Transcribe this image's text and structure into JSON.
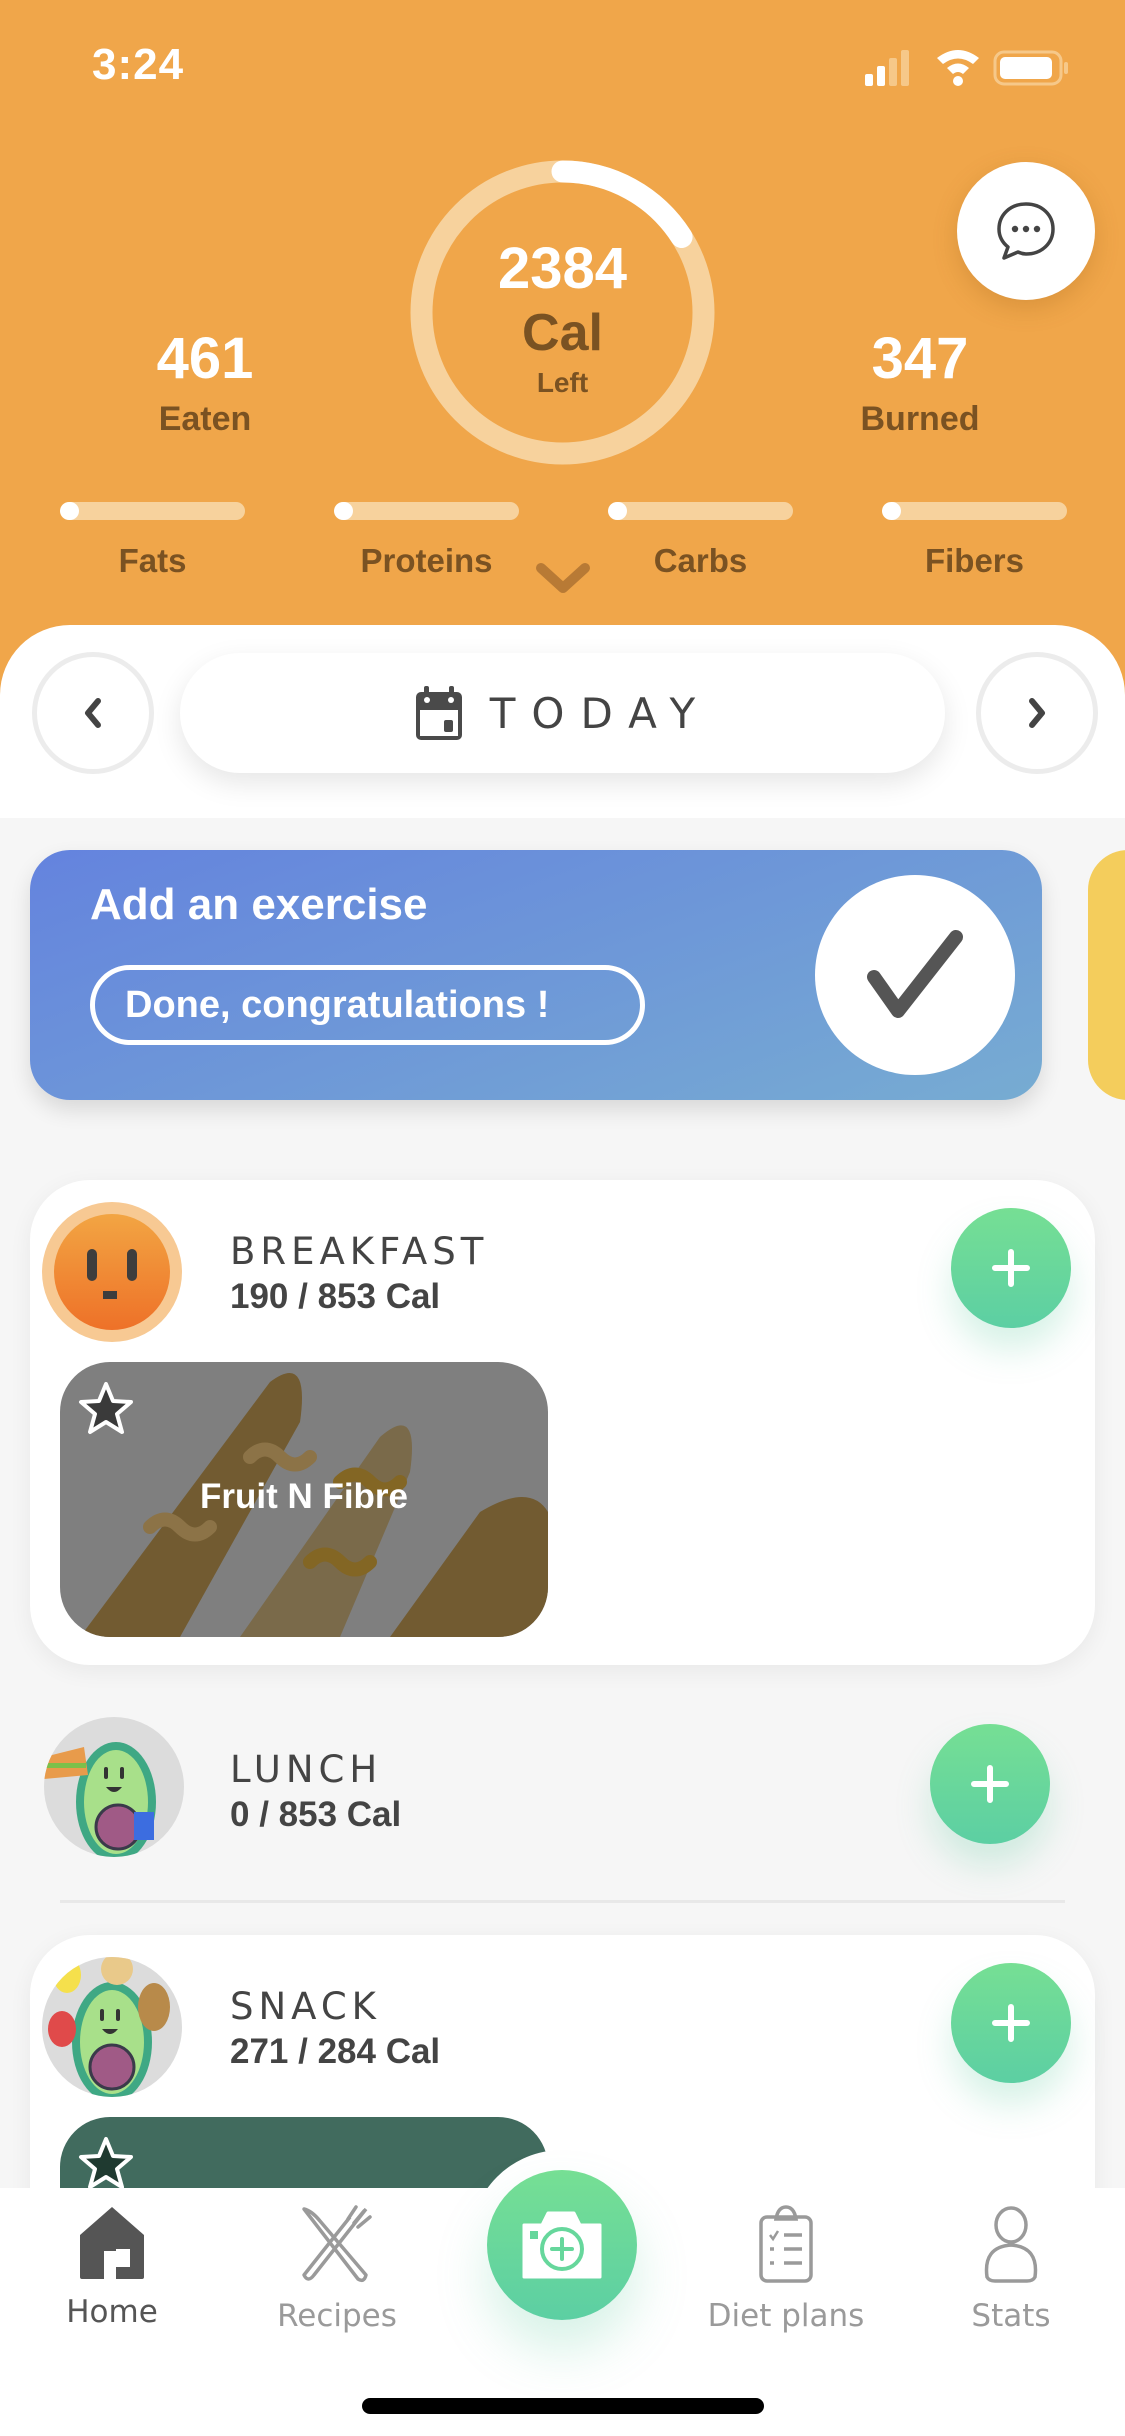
{
  "status_bar": {
    "time": "3:24",
    "icons": [
      "signal-icon",
      "wifi-icon",
      "battery-icon"
    ]
  },
  "summary": {
    "calories_left": "2384",
    "calories_unit": "Cal",
    "calories_sub": "Left",
    "ring_progress": 0.16,
    "eaten": {
      "value": "461",
      "label": "Eaten"
    },
    "burned": {
      "value": "347",
      "label": "Burned"
    },
    "macros": [
      {
        "label": "Fats",
        "progress": 0.08
      },
      {
        "label": "Proteins",
        "progress": 0.08
      },
      {
        "label": "Carbs",
        "progress": 0.08
      },
      {
        "label": "Fibers",
        "progress": 0.08
      }
    ],
    "chat_icon": "chat-bubble-icon",
    "expand_icon": "chevron-down-icon"
  },
  "date_nav": {
    "label": "TODAY",
    "prev_icon": "chevron-left-icon",
    "next_icon": "chevron-right-icon",
    "calendar_icon": "calendar-icon"
  },
  "exercise": {
    "title": "Add an exercise",
    "status": "Done, congratulations !",
    "check_icon": "checkmark-icon"
  },
  "meals": [
    {
      "name": "BREAKFAST",
      "calories": "190 / 853 Cal",
      "items": [
        {
          "name": "Fruit N Fibre"
        }
      ]
    },
    {
      "name": "LUNCH",
      "calories": "0 / 853 Cal",
      "items": []
    },
    {
      "name": "SNACK",
      "calories": "271 / 284 Cal",
      "items": [
        {
          "name": ""
        }
      ]
    }
  ],
  "tabbar": {
    "tabs": [
      {
        "label": "Home",
        "icon": "home-icon",
        "active": true
      },
      {
        "label": "Recipes",
        "icon": "fork-knife-icon",
        "active": false
      },
      {
        "label": "Diet plans",
        "icon": "clipboard-icon",
        "active": false
      },
      {
        "label": "Stats",
        "icon": "person-icon",
        "active": false
      }
    ],
    "camera_icon": "camera-add-icon"
  },
  "colors": {
    "header": "#f0a64a",
    "accent_green": "#66d79c",
    "exercise_blue": "#6a8fdb",
    "text_brown": "#7a5222"
  }
}
